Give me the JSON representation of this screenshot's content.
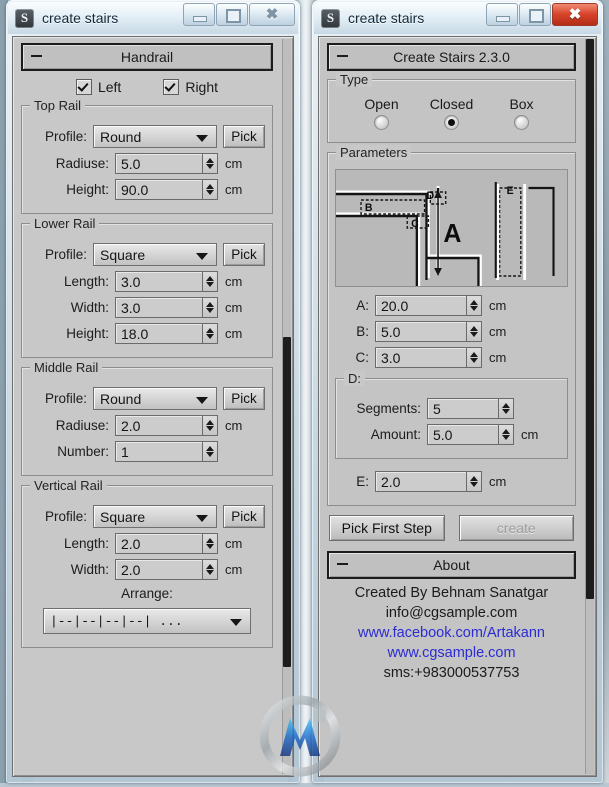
{
  "left_window": {
    "title": "create stairs",
    "icon": "app-icon",
    "buttons": {
      "minimize": "minimize",
      "maximize": "maximize",
      "close": "close"
    },
    "rollout": {
      "title": "Handrail",
      "collapse": "–"
    },
    "handrail": {
      "sides": [
        {
          "label": "Left",
          "checked": true
        },
        {
          "label": "Right",
          "checked": true
        }
      ]
    },
    "groups": [
      {
        "legend": "Top Rail",
        "profile_label": "Profile:",
        "profile_value": "Round",
        "pick_label": "Pick",
        "fields": [
          {
            "label": "Radiuse:",
            "value": "5.0",
            "unit": "cm"
          },
          {
            "label": "Height:",
            "value": "90.0",
            "unit": "cm"
          }
        ]
      },
      {
        "legend": "Lower Rail",
        "profile_label": "Profile:",
        "profile_value": "Square",
        "pick_label": "Pick",
        "fields": [
          {
            "label": "Length:",
            "value": "3.0",
            "unit": "cm"
          },
          {
            "label": "Width:",
            "value": "3.0",
            "unit": "cm"
          },
          {
            "label": "Height:",
            "value": "18.0",
            "unit": "cm"
          }
        ]
      },
      {
        "legend": "Middle Rail",
        "profile_label": "Profile:",
        "profile_value": "Round",
        "pick_label": "Pick",
        "fields": [
          {
            "label": "Radiuse:",
            "value": "2.0",
            "unit": "cm"
          },
          {
            "label": "Number:",
            "value": "1",
            "unit": ""
          }
        ]
      },
      {
        "legend": "Vertical Rail",
        "profile_label": "Profile:",
        "profile_value": "Square",
        "pick_label": "Pick",
        "fields": [
          {
            "label": "Length:",
            "value": "2.0",
            "unit": "cm"
          },
          {
            "label": "Width:",
            "value": "2.0",
            "unit": "cm"
          }
        ],
        "arrange_label": "Arrange:",
        "arrange_value": "|--|--|--|--| ..."
      }
    ]
  },
  "right_window": {
    "title": "create stairs",
    "icon": "app-icon",
    "buttons": {
      "minimize": "minimize",
      "maximize": "maximize",
      "close": "close"
    },
    "close_active_color": "#d8442a",
    "rollout": {
      "title": "Create Stairs 2.3.0",
      "collapse": "–"
    },
    "type": {
      "legend": "Type",
      "options": [
        {
          "label": "Open",
          "selected": false
        },
        {
          "label": "Closed",
          "selected": true
        },
        {
          "label": "Box",
          "selected": false
        }
      ]
    },
    "parameters": {
      "legend": "Parameters",
      "diagram_labels": [
        "A",
        "B",
        "C",
        "D",
        "E"
      ],
      "fields": [
        {
          "label": "A:",
          "value": "20.0",
          "unit": "cm"
        },
        {
          "label": "B:",
          "value": "5.0",
          "unit": "cm"
        },
        {
          "label": "C:",
          "value": "3.0",
          "unit": "cm"
        }
      ],
      "d_group": {
        "legend": "D:",
        "fields": [
          {
            "label": "Segments:",
            "value": "5",
            "unit": ""
          },
          {
            "label": "Amount:",
            "value": "5.0",
            "unit": "cm"
          }
        ]
      },
      "e_field": {
        "label": "E:",
        "value": "2.0",
        "unit": "cm"
      }
    },
    "actions": {
      "pick_first_step": "Pick First Step",
      "create": "create",
      "create_disabled": true
    },
    "about": {
      "rollout_title": "About",
      "collapse": "–",
      "author": "Created By Behnam Sanatgar",
      "email": "info@cgsample.com",
      "facebook": "www.facebook.com/Artakann",
      "website": "www.cgsample.com",
      "sms": "sms:+983000537753",
      "link_color": "#2b2bd4"
    }
  },
  "watermark": {
    "name": "cg-logo-watermark"
  }
}
